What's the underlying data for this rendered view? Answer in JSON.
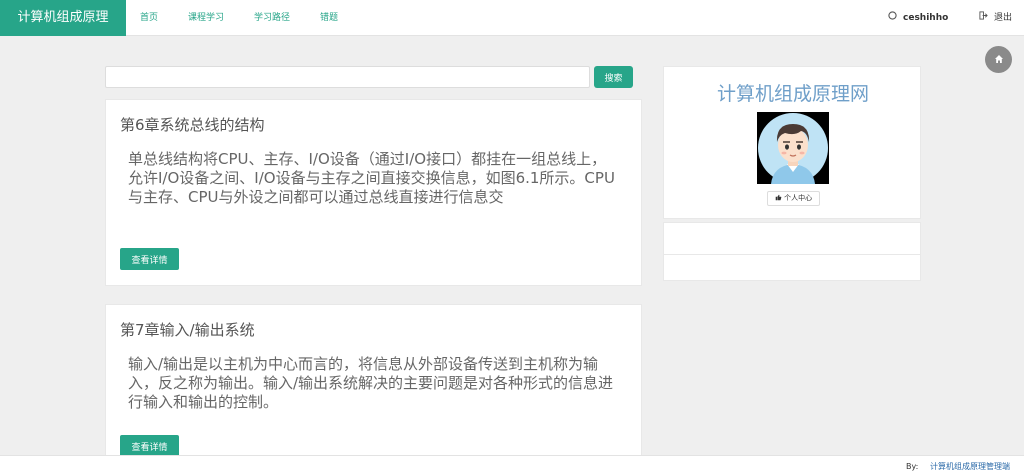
{
  "navbar": {
    "brand": "计算机组成原理",
    "items": [
      "首页",
      "课程学习",
      "学习路径",
      "错题"
    ],
    "user": "ceshihho",
    "logout": "退出",
    "user_icon": "user-circle-icon",
    "logout_icon": "sign-out-icon"
  },
  "home_button_icon": "home-icon",
  "search": {
    "value": "",
    "placeholder": "",
    "button_label": "搜索"
  },
  "articles": [
    {
      "title": "第6章系统总线的结构",
      "body": "单总线结构将CPU、主存、I/O设备（通过I/O接口）都挂在一组总线上，允许I/O设备之间、I/O设备与主存之间直接交换信息，如图6.1所示。CPU与主存、CPU与外设之间都可以通过总线直接进行信息交",
      "button_label": "查看详情"
    },
    {
      "title": "第7章输入/输出系统",
      "body": "输入/输出是以主机为中心而言的，将信息从外部设备传送到主机称为输入，反之称为输出。输入/输出系统解决的主要问题是对各种形式的信息进行输入和输出的控制。",
      "button_label": "查看详情"
    }
  ],
  "sidebar": {
    "title": "计算机组成原理网",
    "profile_button": "个人中心",
    "profile_icon": "thumbs-up-icon"
  },
  "footer": {
    "by_label": "By:",
    "link_text": "计算机组成原理管理端"
  },
  "colors": {
    "accent": "#27a589",
    "sidebar_title": "#6f9fc9",
    "footer_link": "#2b6aa8"
  }
}
